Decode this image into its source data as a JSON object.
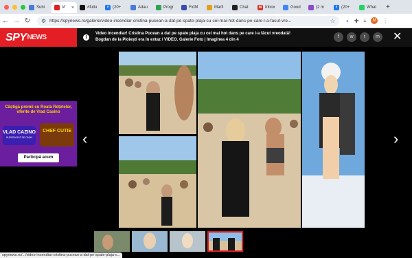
{
  "browser": {
    "tabs": [
      {
        "label": "Subi",
        "fav": "",
        "color": "#4a7bd9"
      },
      {
        "label": "Vi",
        "fav": "",
        "color": "#e31e24",
        "active": true
      },
      {
        "label": "#fullu",
        "fav": "",
        "color": "#111111"
      },
      {
        "label": "(20+",
        "fav": "f",
        "color": "#1877f2"
      },
      {
        "label": "Adau",
        "fav": "",
        "color": "#4a7bd9"
      },
      {
        "label": "Progr",
        "fav": "",
        "color": "#2ea44f"
      },
      {
        "label": "FidM",
        "fav": "",
        "color": "#3a4bb0"
      },
      {
        "label": "Marfi",
        "fav": "",
        "color": "#e0a020"
      },
      {
        "label": "Chat",
        "fav": "",
        "color": "#222222"
      },
      {
        "label": "Inbox",
        "fav": "M",
        "color": "#d93025"
      },
      {
        "label": "Good",
        "fav": "",
        "color": "#4285f4"
      },
      {
        "label": "(2 m",
        "fav": "",
        "color": "#8a4cc9"
      },
      {
        "label": "(20+",
        "fav": "f",
        "color": "#1877f2"
      },
      {
        "label": "What",
        "fav": "",
        "color": "#25d366"
      }
    ],
    "new_tab": "+",
    "url": "https://spynews.ro/galerie/video-incendiar-cristina-pucean-a-dat-pe-spate-plaja-cu-cel-mai-hot-dans-pe-care-l-a-facut-vre...",
    "profile_initial": "M"
  },
  "site": {
    "logo": "SPY",
    "logo_suffix": "NEWS",
    "headline": "Video incendiar! Cristina Pucean a dat pe spate plaja cu cel mai hot dans pe care l-a făcut vreodată! Bogdan de la Ploiești era în extaz / VIDEO. Galerie Foto | Imaginea 4 din 4",
    "share_icons": [
      "f",
      "w",
      "t",
      "m"
    ]
  },
  "ad": {
    "headline": "Câștigă premii cu Roata Rețetelor, oferite de Vlad Casino",
    "brand": "VLAD CAZINO",
    "brand_sub": "SUPERVIZAT DE ONJN",
    "game": "CHEF CUTIE",
    "cta": "Participă acum"
  },
  "status_url": "spynews.ro/.../video-incendiar-cristina-pucean-a-dat-pe-spate-plaja-c...",
  "colors": {
    "brand": "#e31e24",
    "selected_thumb": "#e31e24"
  }
}
